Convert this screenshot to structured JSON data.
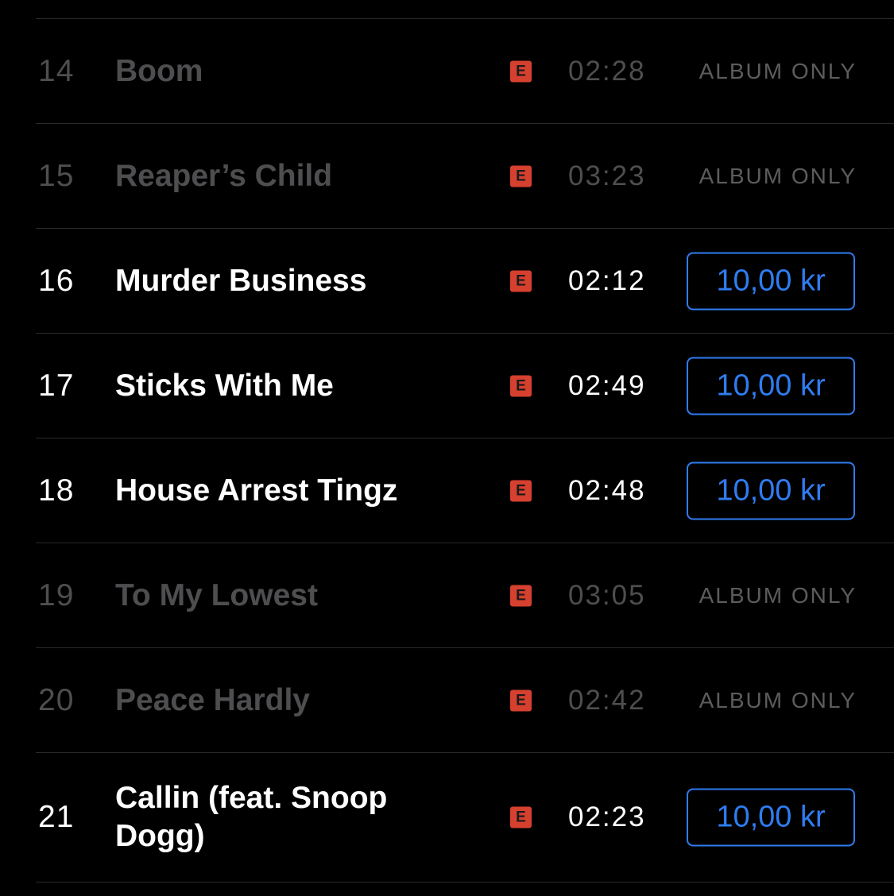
{
  "tracks": [
    {
      "number": "14",
      "title": "Boom",
      "explicit": "E",
      "duration": "02:28",
      "availability": "ALBUM ONLY",
      "price": null
    },
    {
      "number": "15",
      "title": "Reaper’s Child",
      "explicit": "E",
      "duration": "03:23",
      "availability": "ALBUM ONLY",
      "price": null
    },
    {
      "number": "16",
      "title": "Murder Business",
      "explicit": "E",
      "duration": "02:12",
      "availability": null,
      "price": "10,00 kr"
    },
    {
      "number": "17",
      "title": "Sticks With Me",
      "explicit": "E",
      "duration": "02:49",
      "availability": null,
      "price": "10,00 kr"
    },
    {
      "number": "18",
      "title": "House Arrest Tingz",
      "explicit": "E",
      "duration": "02:48",
      "availability": null,
      "price": "10,00 kr"
    },
    {
      "number": "19",
      "title": "To My Lowest",
      "explicit": "E",
      "duration": "03:05",
      "availability": "ALBUM ONLY",
      "price": null
    },
    {
      "number": "20",
      "title": "Peace Hardly",
      "explicit": "E",
      "duration": "02:42",
      "availability": "ALBUM ONLY",
      "price": null
    },
    {
      "number": "21",
      "title": "Callin (feat. Snoop Dogg)",
      "explicit": "E",
      "duration": "02:23",
      "availability": null,
      "price": "10,00 kr"
    }
  ],
  "colors": {
    "background": "#000000",
    "text_primary": "#ffffff",
    "text_disabled": "#4e4e50",
    "album_only": "#5c5c5e",
    "accent": "#2f7cf0",
    "explicit_badge": "#d6402f"
  },
  "icons": {
    "explicit": "explicit-badge-icon"
  }
}
